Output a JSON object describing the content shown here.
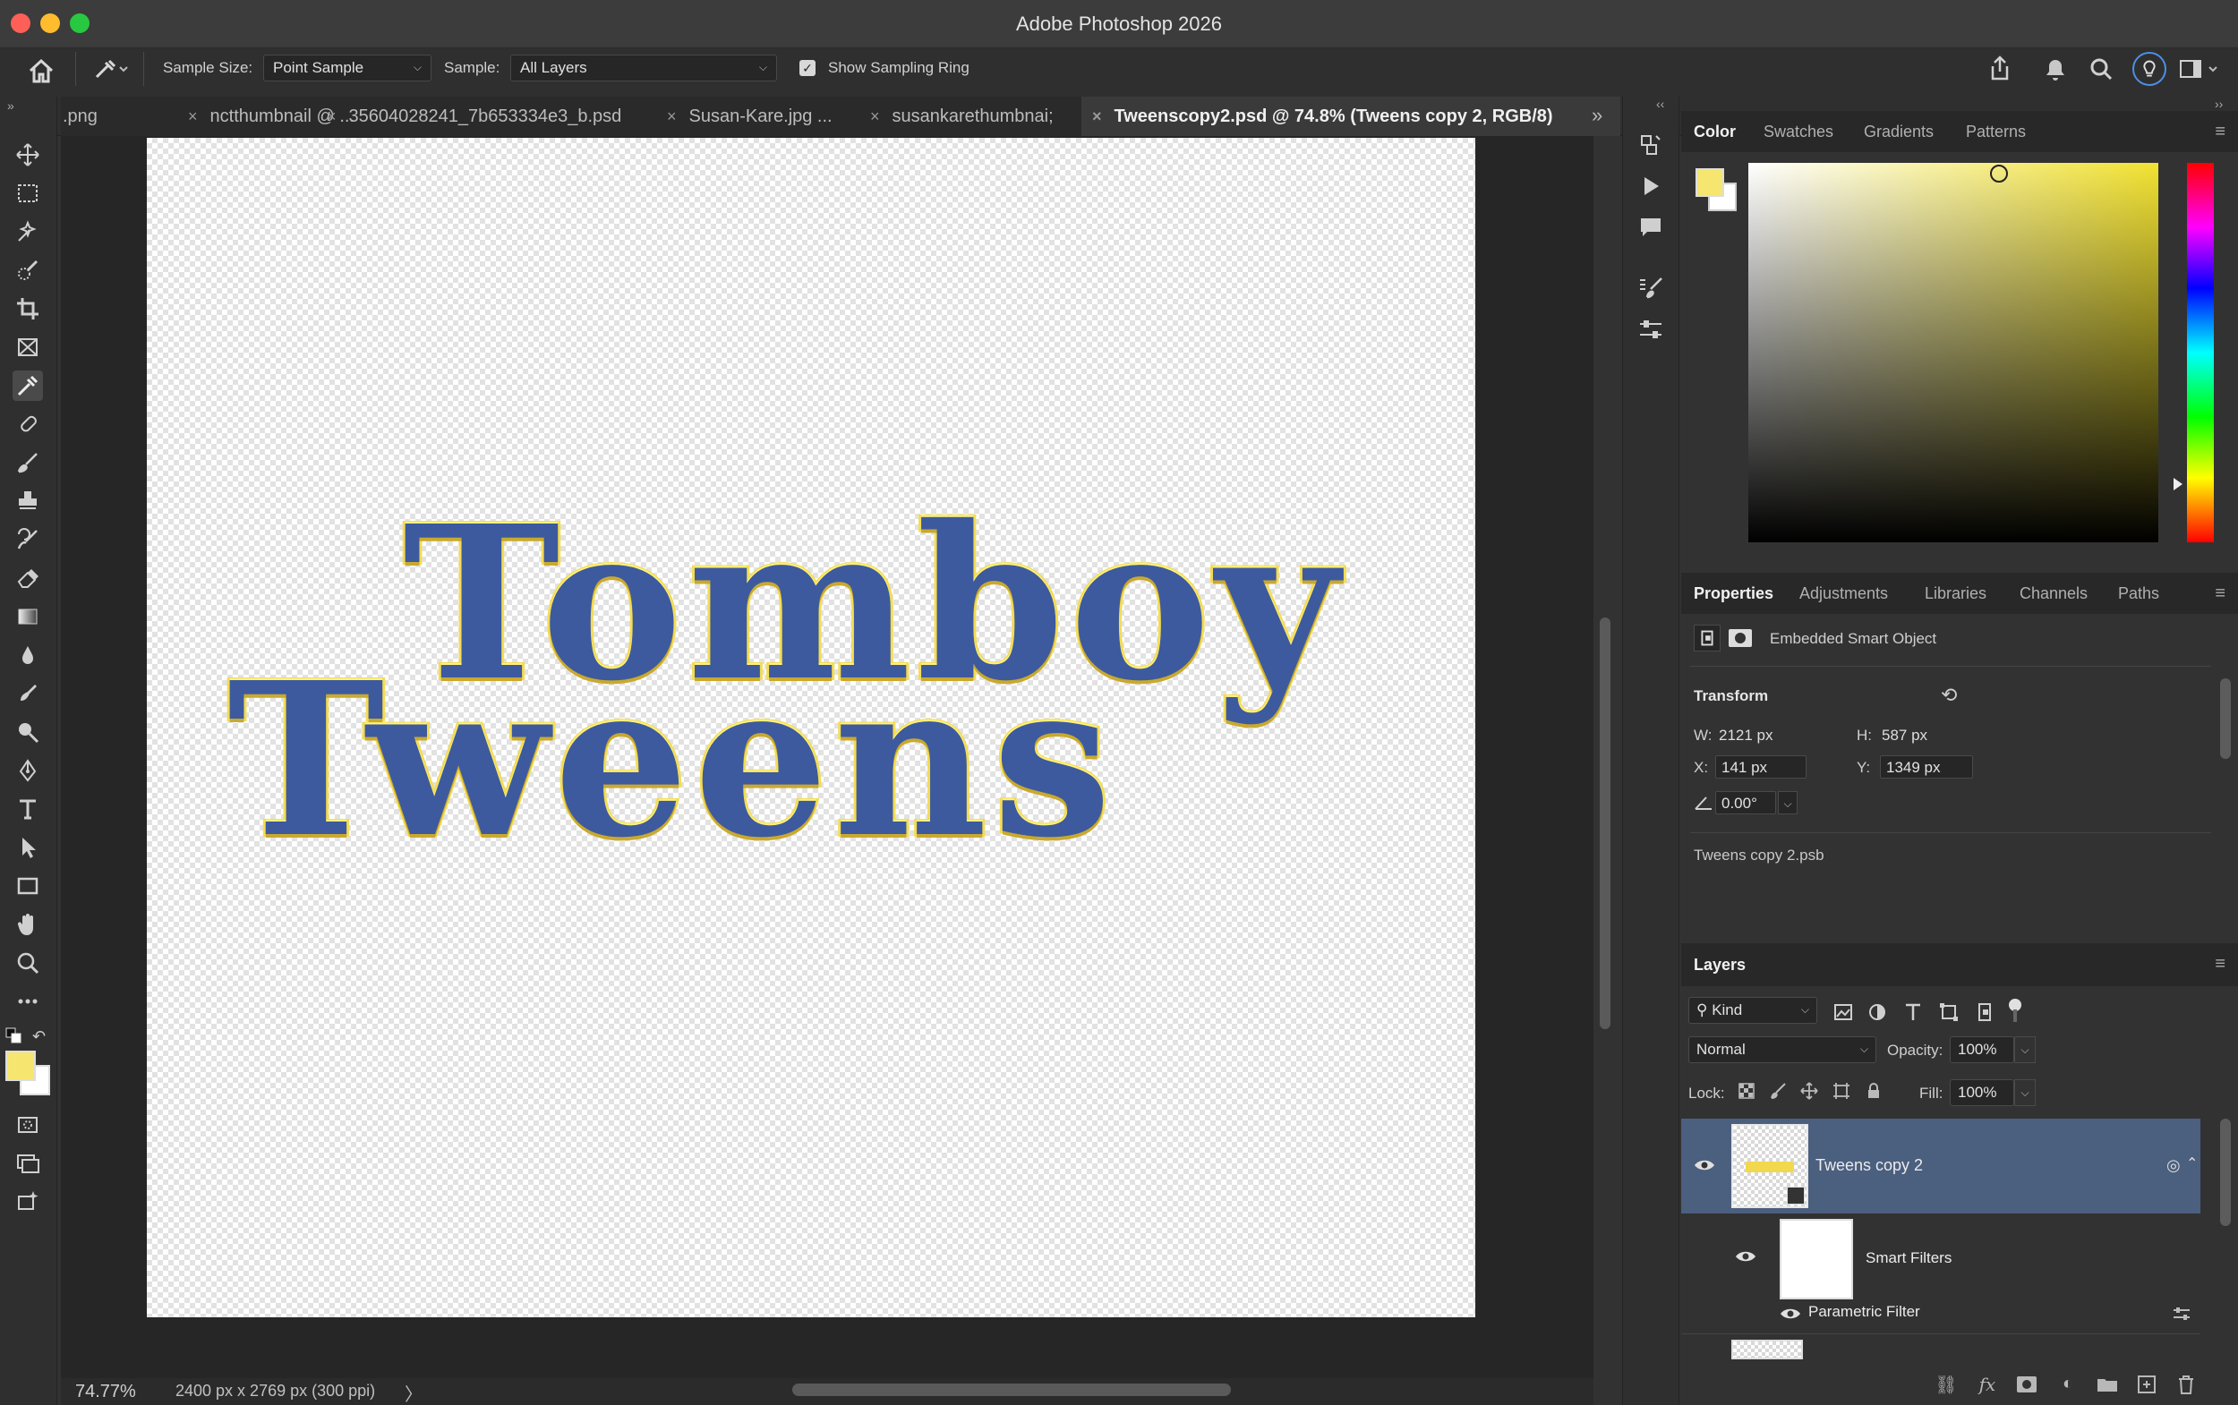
{
  "app": {
    "title": "Adobe Photoshop 2026"
  },
  "options_bar": {
    "sample_size_label": "Sample Size:",
    "sample_size_value": "Point Sample",
    "sample_label": "Sample:",
    "sample_value": "All Layers",
    "show_sampling_ring_label": "Show Sampling Ring",
    "show_sampling_ring_checked": true
  },
  "tabs": [
    {
      "label": ".png",
      "active": false
    },
    {
      "label": "nctthumbnail @ ...",
      "active": false
    },
    {
      "label": "35604028241_7b653334e3_b.psd",
      "active": false
    },
    {
      "label": "Susan-Kare.jpg ...",
      "active": false
    },
    {
      "label": "susankarethumbnai;",
      "active": false
    },
    {
      "label": "Tweenscopy2.psd @ 74.8% (Tweens copy 2, RGB/8)",
      "active": true
    }
  ],
  "tools": [
    "move-tool",
    "marquee-tool",
    "object-select-tool",
    "quick-select-tool",
    "crop-tool",
    "frame-tool",
    "eyedropper-tool",
    "healing-brush-tool",
    "brush-tool",
    "clone-stamp-tool",
    "history-brush-tool",
    "eraser-tool",
    "gradient-tool",
    "blur-tool",
    "smudge-tool",
    "dodge-tool",
    "pen-tool",
    "type-tool",
    "path-select-tool",
    "rectangle-tool",
    "hand-tool",
    "zoom-tool",
    "more-tools"
  ],
  "canvas": {
    "artwork_line1": "Tomboy",
    "artwork_line2": "Tweens"
  },
  "status": {
    "zoom": "74.77%",
    "doc_info": "2400 px x 2769 px (300 ppi)",
    "arrow": "〉"
  },
  "color_panel": {
    "tabs": [
      "Color",
      "Swatches",
      "Gradients",
      "Patterns"
    ],
    "foreground": "#f6e56f",
    "background": "#ffffff"
  },
  "properties_panel": {
    "tabs": [
      "Properties",
      "Adjustments",
      "Libraries",
      "Channels",
      "Paths"
    ],
    "object_type": "Embedded Smart Object",
    "transform_label": "Transform",
    "w_label": "W:",
    "w_value": "2121 px",
    "h_label": "H:",
    "h_value": "587 px",
    "x_label": "X:",
    "x_value": "141 px",
    "y_label": "Y:",
    "y_value": "1349 px",
    "angle_value": "0.00°",
    "linked_file": "Tweens copy 2.psb"
  },
  "layers_panel": {
    "title": "Layers",
    "kind_filter": "Kind",
    "blend_mode": "Normal",
    "opacity_label": "Opacity:",
    "opacity_value": "100%",
    "lock_label": "Lock:",
    "fill_label": "Fill:",
    "fill_value": "100%",
    "layers": [
      {
        "name": "Tweens copy 2",
        "selected": true
      },
      {
        "name": "Smart Filters",
        "selected": false
      },
      {
        "name": "Parametric Filter",
        "selected": false
      }
    ]
  }
}
